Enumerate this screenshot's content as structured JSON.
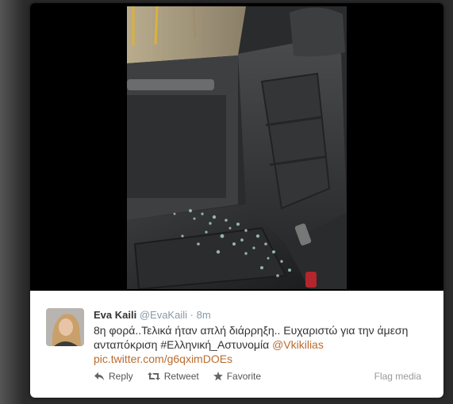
{
  "tweet": {
    "author_name": "Eva Kaili",
    "author_handle": "@EvaKaili",
    "separator": "·",
    "time": "8m",
    "text_line1": "8η φορά..Τελικά ήταν απλή διάρρηξη.. Ευχαριστώ για την άμεση",
    "text_line2_start": "ανταπόκριση #Ελληνική_Αστυνομία",
    "mention": "@Vkikilias",
    "pic_link": "pic.twitter.com/g6qximDOEs"
  },
  "actions": {
    "reply": "Reply",
    "retweet": "Retweet",
    "favorite": "Favorite"
  },
  "flag_media": "Flag media",
  "icons": [
    "reply-icon",
    "retweet-icon",
    "favorite-icon"
  ],
  "colors": {
    "link": "#bb6b2d",
    "muted": "#8899a6",
    "text": "#333333",
    "modal_bg": "#000000"
  }
}
